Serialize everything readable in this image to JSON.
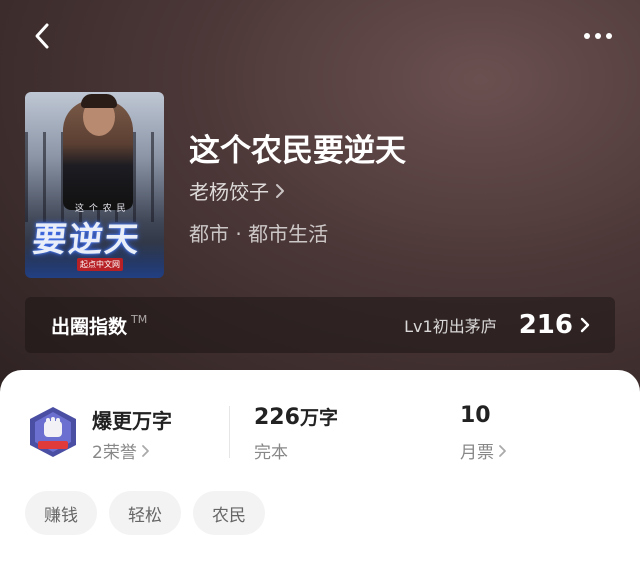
{
  "book": {
    "title": "这个农民要逆天",
    "author": "老杨饺子",
    "genre": "都市 · 都市生活",
    "cover": {
      "small_text": "这 个 农 民",
      "big_text": "要逆天",
      "logo_text": "起点中文网"
    }
  },
  "index_bar": {
    "label": "出圈指数",
    "tm": "TM",
    "level": "Lv1初出茅庐",
    "score": "216"
  },
  "stats": {
    "honor": {
      "title": "爆更万字",
      "sub": "2荣誉"
    },
    "words": {
      "number": "226",
      "unit": "万字",
      "status": "完本"
    },
    "ticket": {
      "number": "10",
      "label": "月票"
    }
  },
  "tags": [
    "赚钱",
    "轻松",
    "农民"
  ],
  "icons": {
    "back": "back-chevron-icon",
    "more": "more-dots-icon",
    "badge": "fist-badge-icon"
  },
  "colors": {
    "hero_bg": "#4a3636",
    "sheet_bg": "#ffffff",
    "tag_bg": "#f3f3f3"
  }
}
